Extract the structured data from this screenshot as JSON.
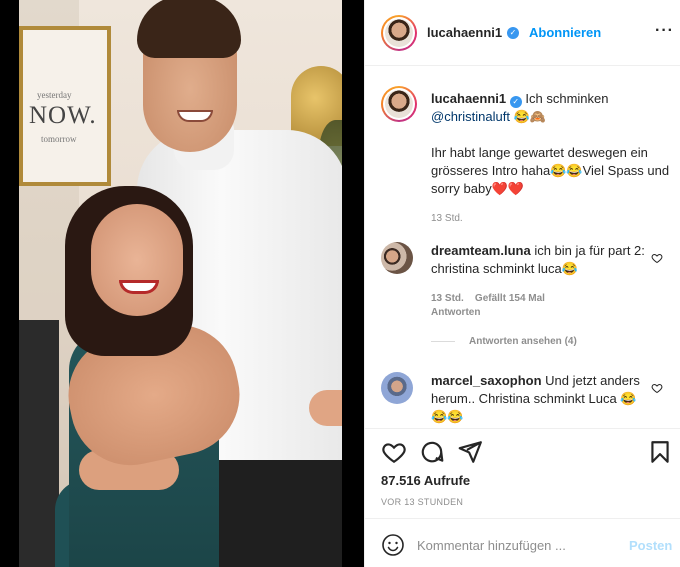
{
  "media": {
    "wall_art": {
      "line1": "yesterday",
      "line2": "NOW.",
      "line3": "tomorrow"
    }
  },
  "post": {
    "author": "lucahaenni1",
    "follow_label": "Abonnieren",
    "more_icon": "more-horizontal-icon",
    "caption": {
      "username": "lucahaenni1",
      "intro": "Ich schminken",
      "mention": "@christinaluft",
      "emoji_1": "😂🙈",
      "body": "Ihr habt lange gewartet deswegen ein grösseres Intro haha😂😂Viel Spass und sorry baby❤️❤️",
      "time": "13 Std."
    },
    "comments": [
      {
        "username": "dreamteam.luna",
        "text": "ich bin ja für part 2: christina schminkt luca😂",
        "time": "13 Std.",
        "likes": "Gefällt 154 Mal",
        "reply": "Antworten",
        "view_replies": "Antworten ansehen (4)"
      },
      {
        "username": "marcel_saxophon",
        "text": "Und jetzt anders herum.. Christina schminkt Luca 😂😂😂"
      }
    ],
    "views": "87.516 Aufrufe",
    "posted_ago": "VOR 13 STUNDEN",
    "composer": {
      "placeholder": "Kommentar hinzufügen ...",
      "post_label": "Posten"
    }
  },
  "colors": {
    "accent": "#0095f6",
    "heart": "#ed4956",
    "mention": "#00376b",
    "muted": "#8e8e8e"
  }
}
